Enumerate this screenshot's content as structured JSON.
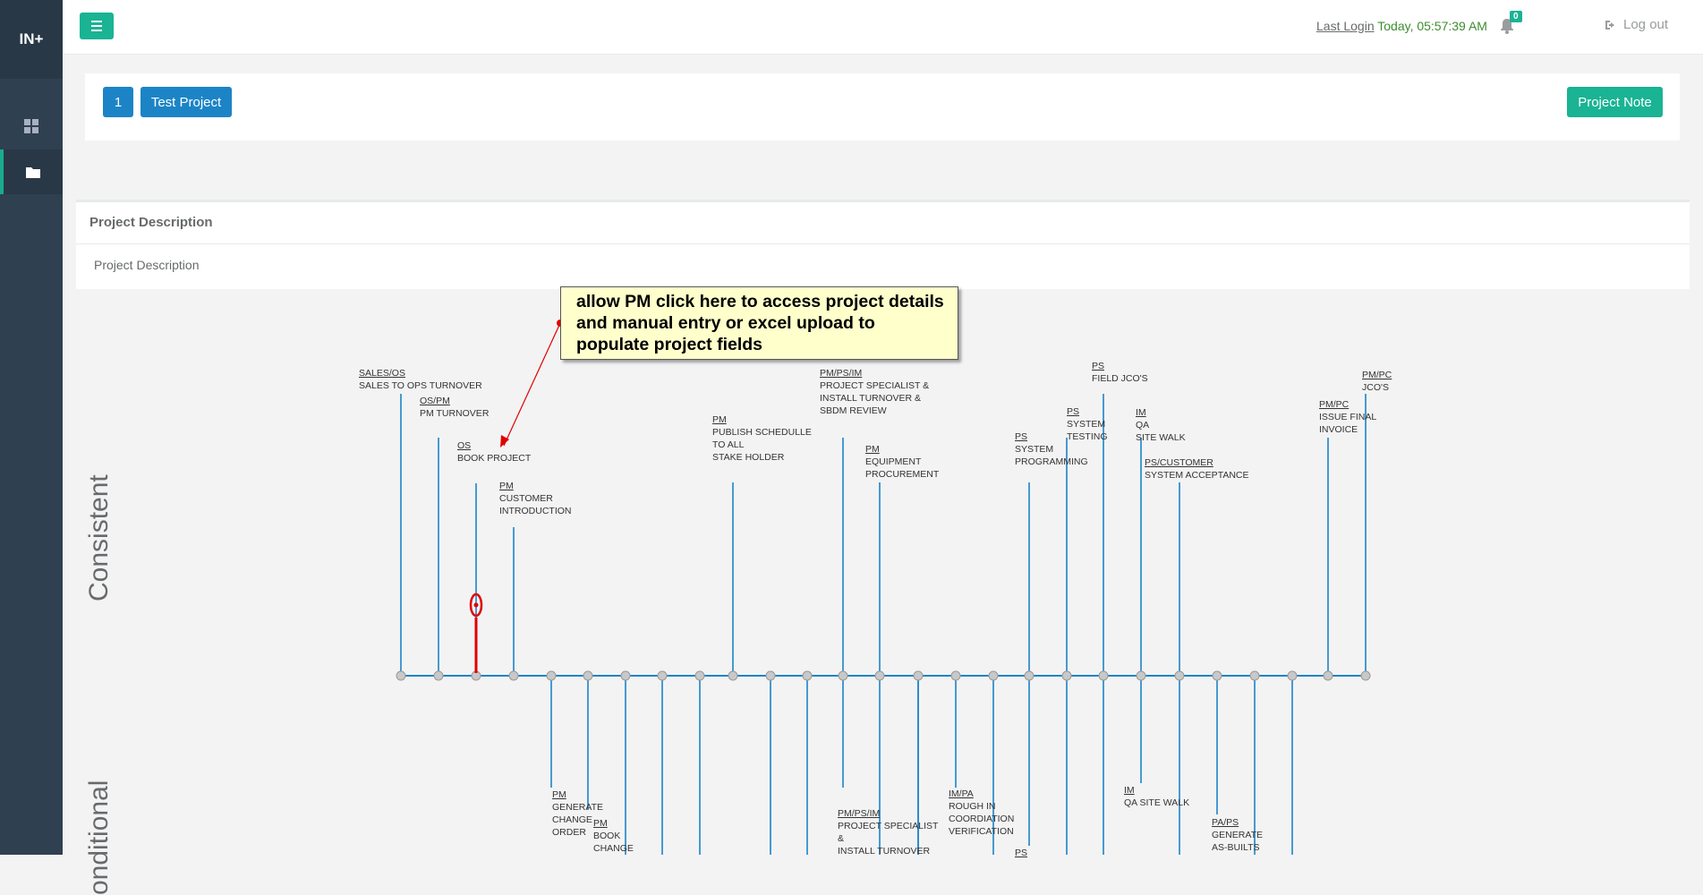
{
  "app": {
    "logo": "IN+"
  },
  "header": {
    "last_login_label": "Last Login",
    "last_login_value": "Today, 05:57:39 AM",
    "notification_count": "0",
    "logout_label": "Log out"
  },
  "project": {
    "number": "1",
    "name": "Test Project",
    "note_button": "Project Note"
  },
  "description": {
    "title": "Project Description",
    "body": "Project Description"
  },
  "timeline": {
    "consistent_label": "Consistent",
    "conditional_label": "onditional",
    "top_milestones": [
      {
        "role": "SALES/OS",
        "desc": [
          "SALES TO OPS TURNOVER"
        ]
      },
      {
        "role": "OS/PM",
        "desc": [
          "PM TURNOVER"
        ]
      },
      {
        "role": "OS",
        "desc": [
          "BOOK PROJECT"
        ]
      },
      {
        "role": "PM",
        "desc": [
          "CUSTOMER",
          "INTRODUCTION"
        ]
      },
      {
        "role": "PM",
        "desc": [
          "PUBLISH SCHEDULLE",
          "TO ALL",
          "STAKE HOLDER"
        ]
      },
      {
        "role": "PM/PS/IM",
        "desc": [
          "PROJECT SPECIALIST &",
          "INSTALL TURNOVER &",
          "SBDM REVIEW"
        ]
      },
      {
        "role": "PM",
        "desc": [
          "EQUIPMENT",
          "PROCUREMENT"
        ]
      },
      {
        "role": "PS",
        "desc": [
          "SYSTEM",
          "PROGRAMMING"
        ]
      },
      {
        "role": "PS",
        "desc": [
          "SYSTEM",
          "TESTING"
        ]
      },
      {
        "role": "PS",
        "desc": [
          "FIELD JCO'S"
        ]
      },
      {
        "role": "IM",
        "desc": [
          "QA",
          "SITE WALK"
        ]
      },
      {
        "role": "PS/CUSTOMER",
        "desc": [
          "SYSTEM ACCEPTANCE"
        ]
      },
      {
        "role": "PM/PC",
        "desc": [
          "ISSUE FINAL",
          "INVOICE"
        ]
      },
      {
        "role": "PM/PC",
        "desc": [
          "JCO'S"
        ]
      }
    ],
    "bottom_milestones": [
      {
        "role": "PM",
        "desc": [
          "GENERATE",
          "CHANGE",
          "ORDER"
        ]
      },
      {
        "role": "PM",
        "desc": [
          "BOOK",
          "CHANGE"
        ]
      },
      {
        "role": "PM/PS/IM",
        "desc": [
          "PROJECT SPECIALIST",
          "&",
          "INSTALL TURNOVER"
        ]
      },
      {
        "role": "IM/PA",
        "desc": [
          "ROUGH IN",
          "COORDIATION",
          "VERIFICATION"
        ]
      },
      {
        "role": "PS",
        "desc": []
      },
      {
        "role": "IM",
        "desc": [
          "QA SITE WALK"
        ]
      },
      {
        "role": "PA/PS",
        "desc": [
          "GENERATE",
          "AS-BUILTS"
        ]
      }
    ],
    "callout": "allow PM click here to access project details and manual entry or excel upload to populate project fields"
  },
  "colors": {
    "sidebar": "#2f4050",
    "accent": "#1ab394",
    "primary": "#1c84c6",
    "timeline": "#1c84c6",
    "node": "#c8c8c8",
    "annotation_red": "#e00000"
  }
}
